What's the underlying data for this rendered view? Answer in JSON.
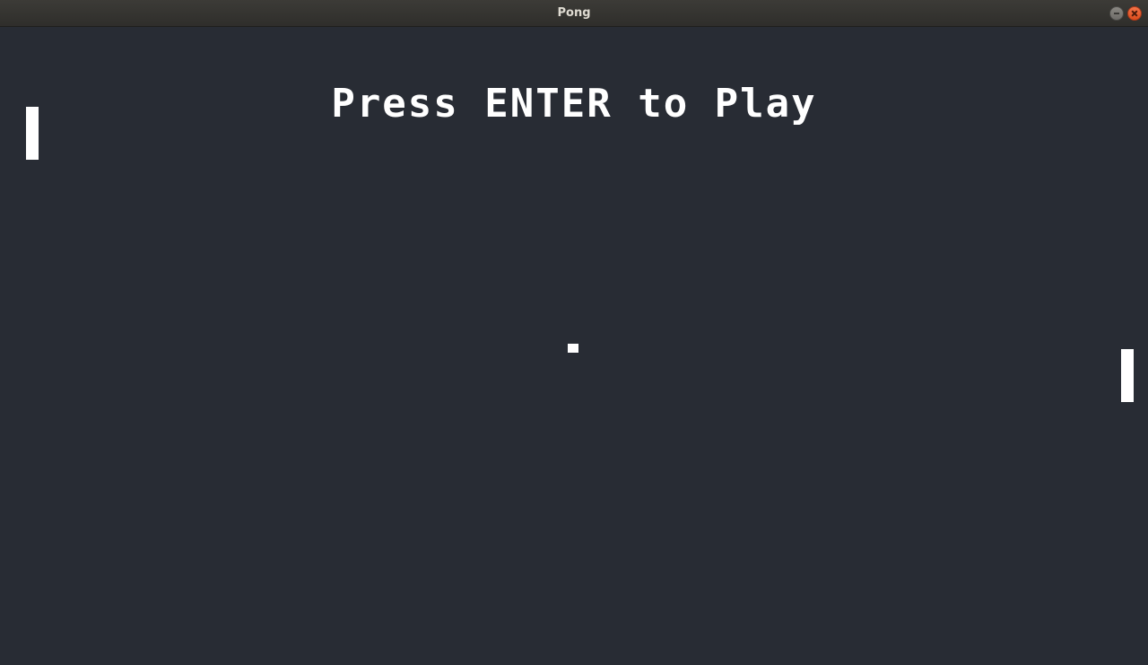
{
  "window": {
    "title": "Pong"
  },
  "game": {
    "message": "Press ENTER to Play",
    "background_color": "#282c34",
    "foreground_color": "#ffffff"
  }
}
